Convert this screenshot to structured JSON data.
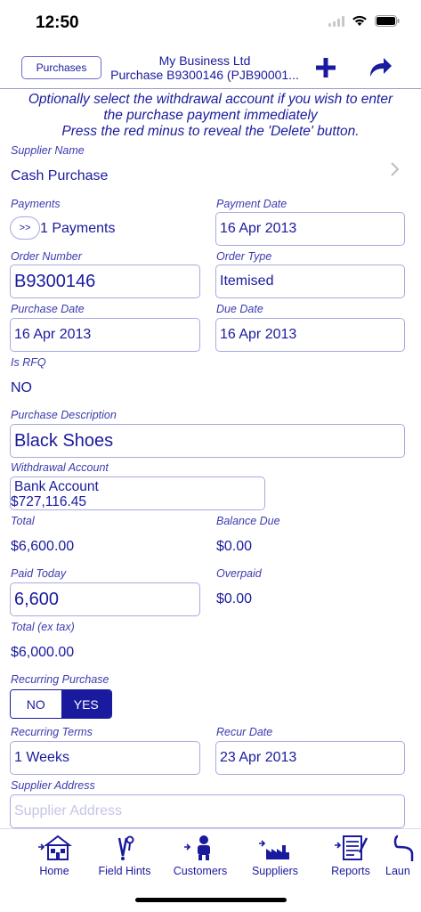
{
  "status": {
    "time": "12:50"
  },
  "nav": {
    "back_label": "Purchases",
    "title_line1": "My Business Ltd",
    "title_line2": "Purchase B9300146 (PJB90001..."
  },
  "banner": {
    "line1": "Optionally select the withdrawal account if you wish to enter",
    "line2": "the purchase payment immediately",
    "line3": "Press the red minus to reveal the 'Delete' button."
  },
  "form": {
    "supplier_name_label": "Supplier Name",
    "supplier_name": "Cash Purchase",
    "payments_label": "Payments",
    "payments_button": ">>",
    "payments_value": "1 Payments",
    "payment_date_label": "Payment Date",
    "payment_date": "16 Apr 2013",
    "order_number_label": "Order Number",
    "order_number": "B9300146",
    "order_type_label": "Order Type",
    "order_type": "Itemised",
    "purchase_date_label": "Purchase Date",
    "purchase_date": "16 Apr 2013",
    "due_date_label": "Due Date",
    "due_date": "16 Apr 2013",
    "is_rfq_label": "Is RFQ",
    "is_rfq": "NO",
    "description_label": "Purchase Description",
    "description": "Black Shoes",
    "withdrawal_label": "Withdrawal Account",
    "withdrawal_account": "Bank Account",
    "withdrawal_balance": "$727,116.45",
    "total_label": "Total",
    "total": "$6,600.00",
    "balance_due_label": "Balance Due",
    "balance_due": "$0.00",
    "paid_today_label": "Paid Today",
    "paid_today": "6,600",
    "overpaid_label": "Overpaid",
    "overpaid": "$0.00",
    "total_ex_tax_label": "Total (ex tax)",
    "total_ex_tax": "$6,000.00",
    "recurring_label": "Recurring Purchase",
    "recurring_no": "NO",
    "recurring_yes": "YES",
    "recurring_selected": "YES",
    "recurring_terms_label": "Recurring Terms",
    "recurring_terms": "1 Weeks",
    "recur_date_label": "Recur Date",
    "recur_date": "23 Apr 2013",
    "supplier_address_label": "Supplier Address",
    "supplier_address_placeholder": "Supplier Address"
  },
  "tabs": [
    {
      "label": "Home",
      "icon": "home-icon"
    },
    {
      "label": "Field Hints",
      "icon": "field-hints-icon"
    },
    {
      "label": "Customers",
      "icon": "customers-icon"
    },
    {
      "label": "Suppliers",
      "icon": "suppliers-icon"
    },
    {
      "label": "Reports",
      "icon": "reports-icon"
    },
    {
      "label": "Laun",
      "icon": "launch-icon"
    }
  ],
  "colors": {
    "accent": "#1a1a9e",
    "border": "#a9a9e0",
    "placeholder": "#c5c5e6"
  }
}
